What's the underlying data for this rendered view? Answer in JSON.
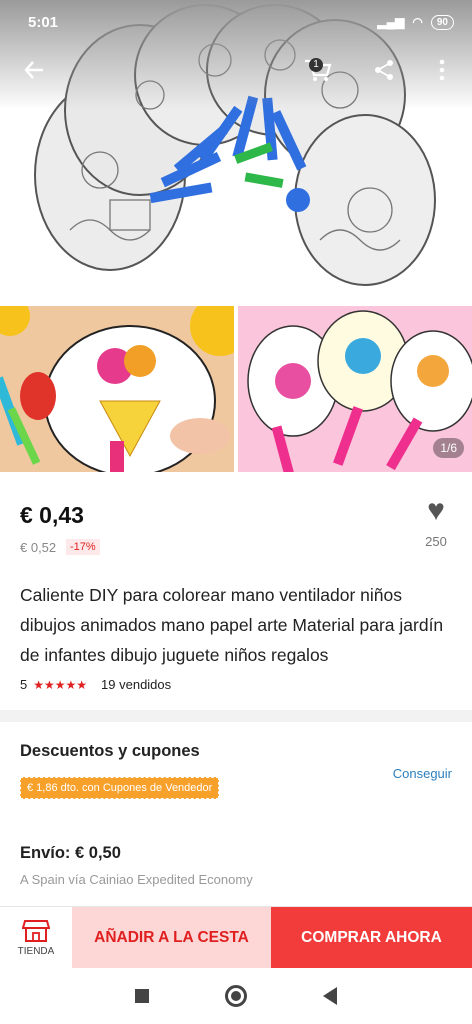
{
  "status_bar": {
    "time": "5:01",
    "battery": "90"
  },
  "header": {
    "cart_count": "1"
  },
  "gallery": {
    "counter": "1/6"
  },
  "price": {
    "current": "€ 0,43",
    "original": "€ 0,52",
    "discount": "-17%"
  },
  "wishlist": {
    "count": "250"
  },
  "product": {
    "title": "Caliente DIY para colorear mano ventilador niños dibujos animados mano papel arte Material para jardín de infantes dibujo juguete niños regalos",
    "rating": "5",
    "stars": "★★★★★",
    "sold": "19 vendidos"
  },
  "coupons": {
    "heading": "Descuentos y cupones",
    "chip": "€ 1,86 dto. con Cupones de Vendedor",
    "action": "Conseguir"
  },
  "shipping": {
    "label": "Envío: € 0,50",
    "via": "A Spain vía Cainiao Expedited Economy"
  },
  "actions": {
    "store": "TIENDA",
    "add_to_cart": "AÑADIR A LA CESTA",
    "buy_now": "COMPRAR AHORA"
  },
  "colors": {
    "accent": "#f23b3b",
    "link": "#2d7fbd",
    "coupon": "#f7a12b"
  }
}
